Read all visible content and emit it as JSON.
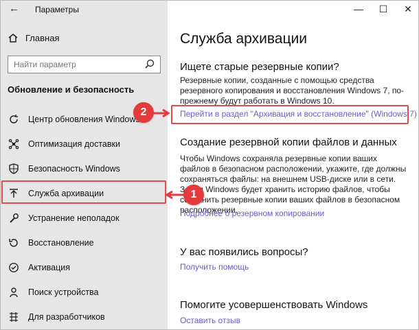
{
  "window": {
    "title": "Параметры"
  },
  "sidebar": {
    "home": "Главная",
    "search_placeholder": "Найти параметр",
    "section": "Обновление и безопасность",
    "items": [
      {
        "label": "Центр обновления Windows"
      },
      {
        "label": "Оптимизация доставки"
      },
      {
        "label": "Безопасность Windows"
      },
      {
        "label": "Служба архивации"
      },
      {
        "label": "Устранение неполадок"
      },
      {
        "label": "Восстановление"
      },
      {
        "label": "Активация"
      },
      {
        "label": "Поиск устройства"
      },
      {
        "label": "Для разработчиков"
      }
    ]
  },
  "main": {
    "title": "Служба архивации",
    "old_backups": {
      "heading": "Ищете старые резервные копии?",
      "text": "Резервные копии, созданные с помощью средства резервного копирования и восстановления Windows 7, по-прежнему будут работать в Windows 10.",
      "link": "Перейти в раздел \"Архивация и восстановление\" (Windows 7)"
    },
    "file_backup": {
      "heading": "Создание резервной копии файлов и данных",
      "text": "Чтобы Windows сохраняла резервные копии ваших файлов в безопасном расположении, укажите, где должны сохраняться файлы: на внешнем USB-диске или в сети. Затем Windows будет хранить историю файлов, чтобы сохранить резервные копии ваших файлов в безопасном расположении.",
      "link": "Подробнее о резервном копировании"
    },
    "questions": {
      "heading": "У вас появились вопросы?",
      "link": "Получить помощь"
    },
    "improve": {
      "heading": "Помогите усовершенствовать Windows",
      "link": "Оставить отзыв"
    }
  },
  "annotations": {
    "step1": "1",
    "step2": "2"
  },
  "colors": {
    "accent_link": "#6a5cc9",
    "highlight": "#e24b4b"
  }
}
